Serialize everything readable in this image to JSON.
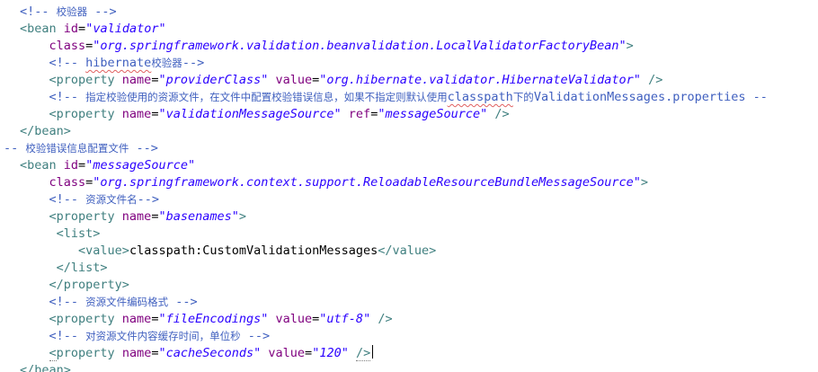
{
  "lines": [
    [
      {
        "c": "cmt",
        "t": "<!-- "
      },
      {
        "c": "cmt cn",
        "t": "校验器"
      },
      {
        "c": "cmt",
        "t": " -->"
      }
    ],
    [
      {
        "c": "tag",
        "t": "<bean "
      },
      {
        "c": "attr",
        "t": "id"
      },
      {
        "c": "txt",
        "t": "="
      },
      {
        "c": "val",
        "t": "\"validator\""
      }
    ],
    [
      {
        "c": "txt",
        "t": "    "
      },
      {
        "c": "attr",
        "t": "class"
      },
      {
        "c": "txt",
        "t": "="
      },
      {
        "c": "val",
        "t": "\"org.springframework.validation.beanvalidation.LocalValidatorFactoryBean\""
      },
      {
        "c": "tag",
        "t": ">"
      }
    ],
    [
      {
        "c": "txt",
        "t": "    "
      },
      {
        "c": "cmt",
        "t": "<!-- "
      },
      {
        "c": "cmt spell",
        "t": "hibernate"
      },
      {
        "c": "cmt cn",
        "t": "校验器"
      },
      {
        "c": "cmt",
        "t": "-->"
      }
    ],
    [
      {
        "c": "txt",
        "t": "    "
      },
      {
        "c": "tag",
        "t": "<property "
      },
      {
        "c": "attr",
        "t": "name"
      },
      {
        "c": "txt",
        "t": "="
      },
      {
        "c": "val",
        "t": "\"providerClass\""
      },
      {
        "c": "txt",
        "t": " "
      },
      {
        "c": "attr",
        "t": "value"
      },
      {
        "c": "txt",
        "t": "="
      },
      {
        "c": "val",
        "t": "\"org.hibernate.validator.HibernateValidator\""
      },
      {
        "c": "txt",
        "t": " "
      },
      {
        "c": "tag",
        "t": "/>"
      }
    ],
    [
      {
        "c": "txt",
        "t": "    "
      },
      {
        "c": "cmt",
        "t": "<!-- "
      },
      {
        "c": "cmt cn",
        "t": "指定校验使用的资源文件，在文件中配置校验错误信息，如果不指定则默认使用"
      },
      {
        "c": "cmt spell",
        "t": "classpath"
      },
      {
        "c": "cmt cn",
        "t": "下的"
      },
      {
        "c": "cmt",
        "t": "ValidationMessages.properties --"
      }
    ],
    [
      {
        "c": "txt",
        "t": "    "
      },
      {
        "c": "tag",
        "t": "<property "
      },
      {
        "c": "attr",
        "t": "name"
      },
      {
        "c": "txt",
        "t": "="
      },
      {
        "c": "val",
        "t": "\"validationMessageSource\""
      },
      {
        "c": "txt",
        "t": " "
      },
      {
        "c": "attr",
        "t": "ref"
      },
      {
        "c": "txt",
        "t": "="
      },
      {
        "c": "val",
        "t": "\"messageSource\""
      },
      {
        "c": "txt",
        "t": " "
      },
      {
        "c": "tag",
        "t": "/>"
      }
    ],
    [
      {
        "c": "tag",
        "t": "</bean>"
      }
    ],
    [
      {
        "c": "cmt",
        "t": "-- "
      },
      {
        "c": "cmt cn",
        "t": "校验错误信息配置文件"
      },
      {
        "c": "cmt",
        "t": " -->"
      }
    ],
    [
      {
        "c": "tag",
        "t": "<bean "
      },
      {
        "c": "attr",
        "t": "id"
      },
      {
        "c": "txt",
        "t": "="
      },
      {
        "c": "val",
        "t": "\"messageSource\""
      }
    ],
    [
      {
        "c": "txt",
        "t": "    "
      },
      {
        "c": "attr",
        "t": "class"
      },
      {
        "c": "txt",
        "t": "="
      },
      {
        "c": "val",
        "t": "\"org.springframework.context.support.ReloadableResourceBundleMessageSource\""
      },
      {
        "c": "tag",
        "t": ">"
      }
    ],
    [
      {
        "c": "txt",
        "t": "    "
      },
      {
        "c": "cmt",
        "t": "<!-- "
      },
      {
        "c": "cmt cn",
        "t": "资源文件名"
      },
      {
        "c": "cmt",
        "t": "-->"
      }
    ],
    [
      {
        "c": "txt",
        "t": "    "
      },
      {
        "c": "tag",
        "t": "<property "
      },
      {
        "c": "attr",
        "t": "name"
      },
      {
        "c": "txt",
        "t": "="
      },
      {
        "c": "val",
        "t": "\"basenames\""
      },
      {
        "c": "tag",
        "t": ">"
      }
    ],
    [
      {
        "c": "txt",
        "t": "     "
      },
      {
        "c": "tag",
        "t": "<list>"
      }
    ],
    [
      {
        "c": "txt",
        "t": "        "
      },
      {
        "c": "tag",
        "t": "<value>"
      },
      {
        "c": "txt",
        "t": "classpath:CustomValidationMessages"
      },
      {
        "c": "tag",
        "t": "</value>"
      }
    ],
    [
      {
        "c": "txt",
        "t": "     "
      },
      {
        "c": "tag",
        "t": "</list>"
      }
    ],
    [
      {
        "c": "txt",
        "t": "    "
      },
      {
        "c": "tag",
        "t": "</property>"
      }
    ],
    [
      {
        "c": "txt",
        "t": "    "
      },
      {
        "c": "cmt",
        "t": "<!-- "
      },
      {
        "c": "cmt cn",
        "t": "资源文件编码格式"
      },
      {
        "c": "cmt",
        "t": " -->"
      }
    ],
    [
      {
        "c": "txt",
        "t": "    "
      },
      {
        "c": "tag",
        "t": "<property "
      },
      {
        "c": "attr",
        "t": "name"
      },
      {
        "c": "txt",
        "t": "="
      },
      {
        "c": "val",
        "t": "\"fileEncodings\""
      },
      {
        "c": "txt",
        "t": " "
      },
      {
        "c": "attr",
        "t": "value"
      },
      {
        "c": "txt",
        "t": "="
      },
      {
        "c": "val",
        "t": "\"utf-8\""
      },
      {
        "c": "txt",
        "t": " "
      },
      {
        "c": "tag",
        "t": "/>"
      }
    ],
    [
      {
        "c": "txt",
        "t": "    "
      },
      {
        "c": "cmt",
        "t": "<!-- "
      },
      {
        "c": "cmt cn",
        "t": "对资源文件内容缓存时间，单位秒"
      },
      {
        "c": "cmt",
        "t": " -->"
      }
    ],
    [
      {
        "c": "txt",
        "t": "    "
      },
      {
        "c": "tag cursor-mark",
        "t": "<"
      },
      {
        "c": "tag",
        "t": "property "
      },
      {
        "c": "attr",
        "t": "name"
      },
      {
        "c": "txt",
        "t": "="
      },
      {
        "c": "val",
        "t": "\"cacheSeconds\""
      },
      {
        "c": "txt",
        "t": " "
      },
      {
        "c": "attr",
        "t": "value"
      },
      {
        "c": "txt",
        "t": "="
      },
      {
        "c": "val",
        "t": "\"120\""
      },
      {
        "c": "txt",
        "t": " "
      },
      {
        "c": "tag cursor-mark",
        "t": "/>"
      }
    ],
    [
      {
        "c": "tag",
        "t": "</bean>"
      }
    ]
  ],
  "colors": {
    "comment": "#3f5fbf",
    "tag": "#3f7f7f",
    "attribute": "#7f007f",
    "value": "#2a00ff",
    "text": "#000000",
    "background": "#ffffff"
  },
  "caret_line": 20
}
